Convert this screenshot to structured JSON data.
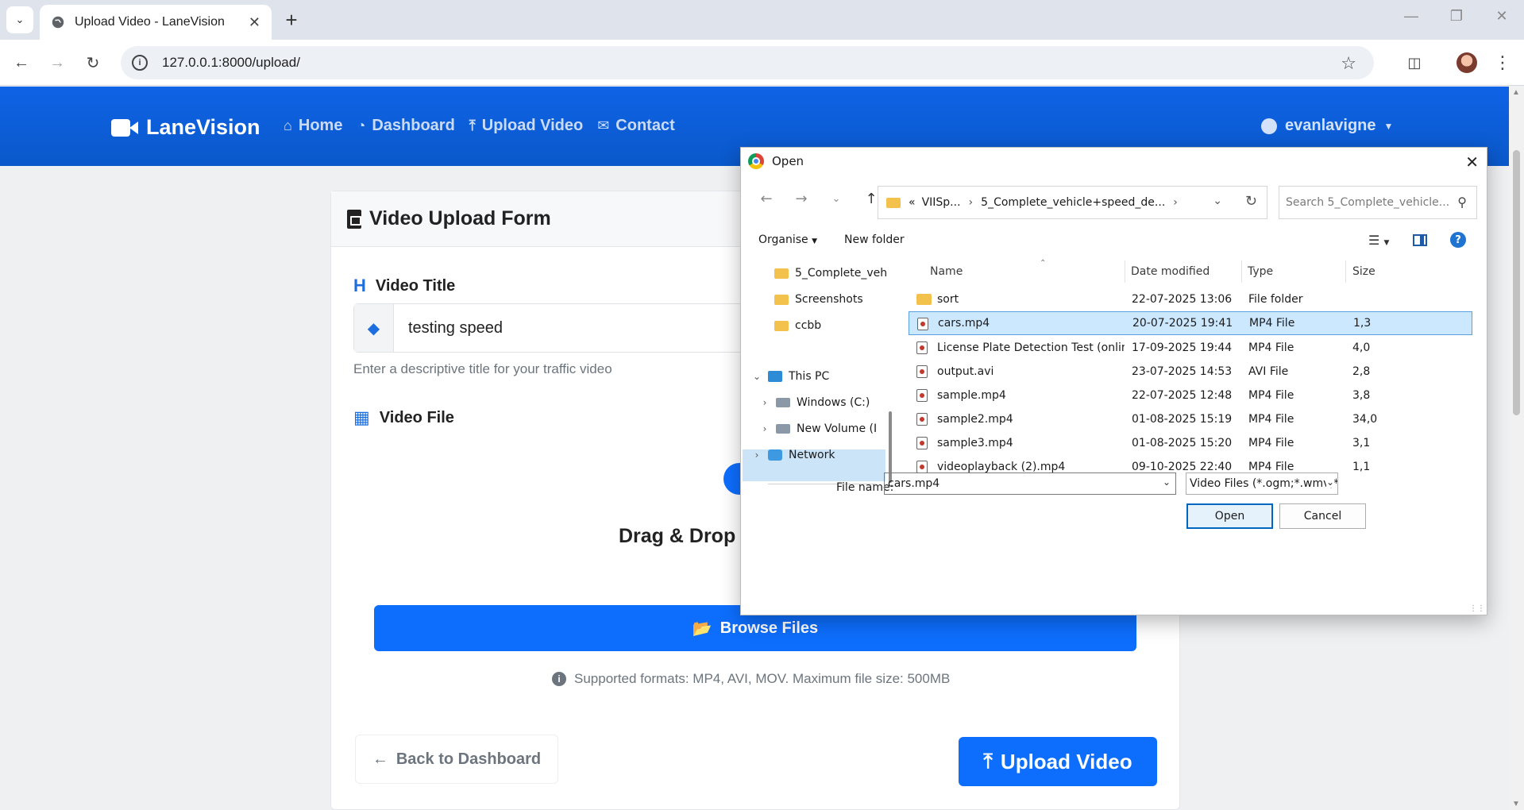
{
  "browser": {
    "tab_title": "Upload Video - LaneVision",
    "url": "127.0.0.1:8000/upload/"
  },
  "site": {
    "brand": "LaneVision",
    "nav": [
      {
        "label": "Home",
        "icon": "home-icon"
      },
      {
        "label": "Dashboard",
        "icon": "dashboard-icon"
      },
      {
        "label": "Upload Video",
        "icon": "upload-icon"
      },
      {
        "label": "Contact",
        "icon": "envelope-icon"
      }
    ],
    "user": "evanlavigne",
    "colors": {
      "primary": "#0d6efd",
      "muted": "#6c757d"
    }
  },
  "form": {
    "header": "Video Upload Form",
    "title_label": "Video Title",
    "title_value": "testing speed",
    "title_help": "Enter a descriptive title for your traffic video",
    "file_label": "Video File",
    "drag_text": "Drag & Drop",
    "browse_label": "Browse Files",
    "formats_text": "Supported formats: MP4, AVI, MOV. Maximum file size: 500MB",
    "back_label": "Back to Dashboard",
    "upload_label": "Upload Video"
  },
  "dialog": {
    "title": "Open",
    "breadcrumb": [
      "«",
      "VIISp...",
      "5_Complete_vehicle+speed_de..."
    ],
    "search_placeholder": "Search 5_Complete_vehicle...",
    "organise": "Organise",
    "new_folder": "New folder",
    "tree": [
      {
        "label": "5_Complete_veh",
        "kind": "folder"
      },
      {
        "label": "Screenshots",
        "kind": "folder"
      },
      {
        "label": "ccbb",
        "kind": "folder"
      },
      {
        "label": "This PC",
        "kind": "pc"
      },
      {
        "label": "Windows (C:)",
        "kind": "drive"
      },
      {
        "label": "New Volume (I",
        "kind": "drive"
      },
      {
        "label": "Network",
        "kind": "network"
      }
    ],
    "columns": [
      "Name",
      "Date modified",
      "Type",
      "Size"
    ],
    "files": [
      {
        "name": "sort",
        "date": "22-07-2025 13:06",
        "type": "File folder",
        "size": ""
      },
      {
        "name": "cars.mp4",
        "date": "20-07-2025 19:41",
        "type": "MP4 File",
        "size": "1,3"
      },
      {
        "name": "License Plate Detection Test (online-vide...",
        "date": "17-09-2025 19:44",
        "type": "MP4 File",
        "size": "4,0"
      },
      {
        "name": "output.avi",
        "date": "23-07-2025 14:53",
        "type": "AVI File",
        "size": "2,8"
      },
      {
        "name": "sample.mp4",
        "date": "22-07-2025 12:48",
        "type": "MP4 File",
        "size": "3,8"
      },
      {
        "name": "sample2.mp4",
        "date": "01-08-2025 15:19",
        "type": "MP4 File",
        "size": "34,0"
      },
      {
        "name": "sample3.mp4",
        "date": "01-08-2025 15:20",
        "type": "MP4 File",
        "size": "3,1"
      },
      {
        "name": "videoplayback (2).mp4",
        "date": "09-10-2025 22:40",
        "type": "MP4 File",
        "size": "1,1"
      }
    ],
    "file_name_label": "File name:",
    "file_name_value": "cars.mp4",
    "file_type_value": "Video Files (*.ogm;*.wmv;*.mpg",
    "open_label": "Open",
    "cancel_label": "Cancel"
  }
}
